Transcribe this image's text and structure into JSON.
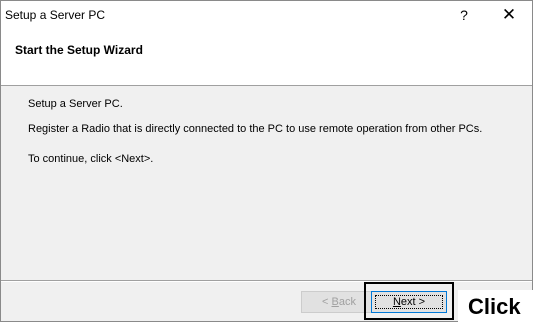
{
  "window": {
    "title": "Setup a Server PC",
    "help_glyph": "?",
    "close_glyph": "✕"
  },
  "header": {
    "title": "Start the Setup Wizard"
  },
  "body": {
    "line1": "Setup a Server PC.",
    "line2": "Register a Radio that is directly connected to the PC to use remote operation from other PCs.",
    "line3": "To continue, click <Next>."
  },
  "buttons": {
    "back_prefix": "< ",
    "back_accel": "B",
    "back_suffix": "ack",
    "next_accel": "N",
    "next_suffix": "ext >"
  },
  "annotation": {
    "label": "Click"
  }
}
